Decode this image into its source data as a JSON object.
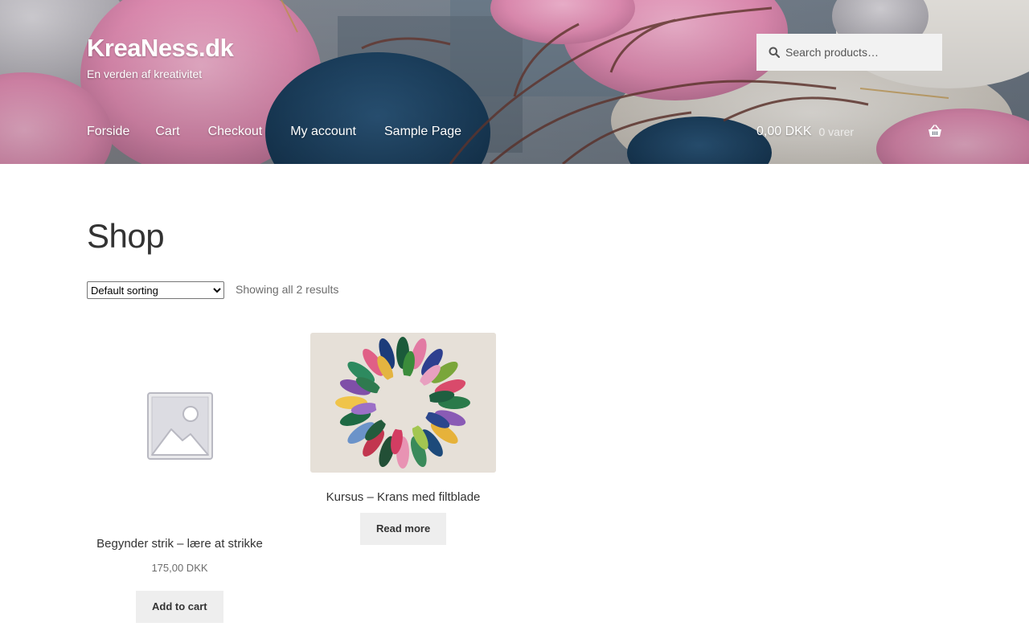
{
  "header": {
    "site_title": "KreaNess.dk",
    "tagline": "En verden af kreativitet",
    "search_placeholder": "Search products…",
    "search_icon": "search-icon",
    "nav": [
      "Forside",
      "Cart",
      "Checkout",
      "My account",
      "Sample Page"
    ],
    "cart": {
      "amount": "0,00 DKK",
      "count": "0 varer",
      "icon": "basket-icon"
    }
  },
  "main": {
    "title": "Shop",
    "sorting": {
      "selected": "Default sorting",
      "options": [
        "Default sorting"
      ]
    },
    "result_count": "Showing all 2 results",
    "products": [
      {
        "title": "Begynder strik – lære at strikke",
        "price": "175,00 DKK",
        "button": "Add to cart",
        "image": "placeholder-image-icon"
      },
      {
        "title": "Kursus – Krans med filtblade",
        "button": "Read more",
        "image": "felt-leaf-wreath-photo"
      }
    ]
  },
  "colors": {
    "header_text": "#ffffff",
    "search_bg": "#f2f2f2",
    "button_bg": "#eeeeee",
    "title_text": "#333333"
  }
}
